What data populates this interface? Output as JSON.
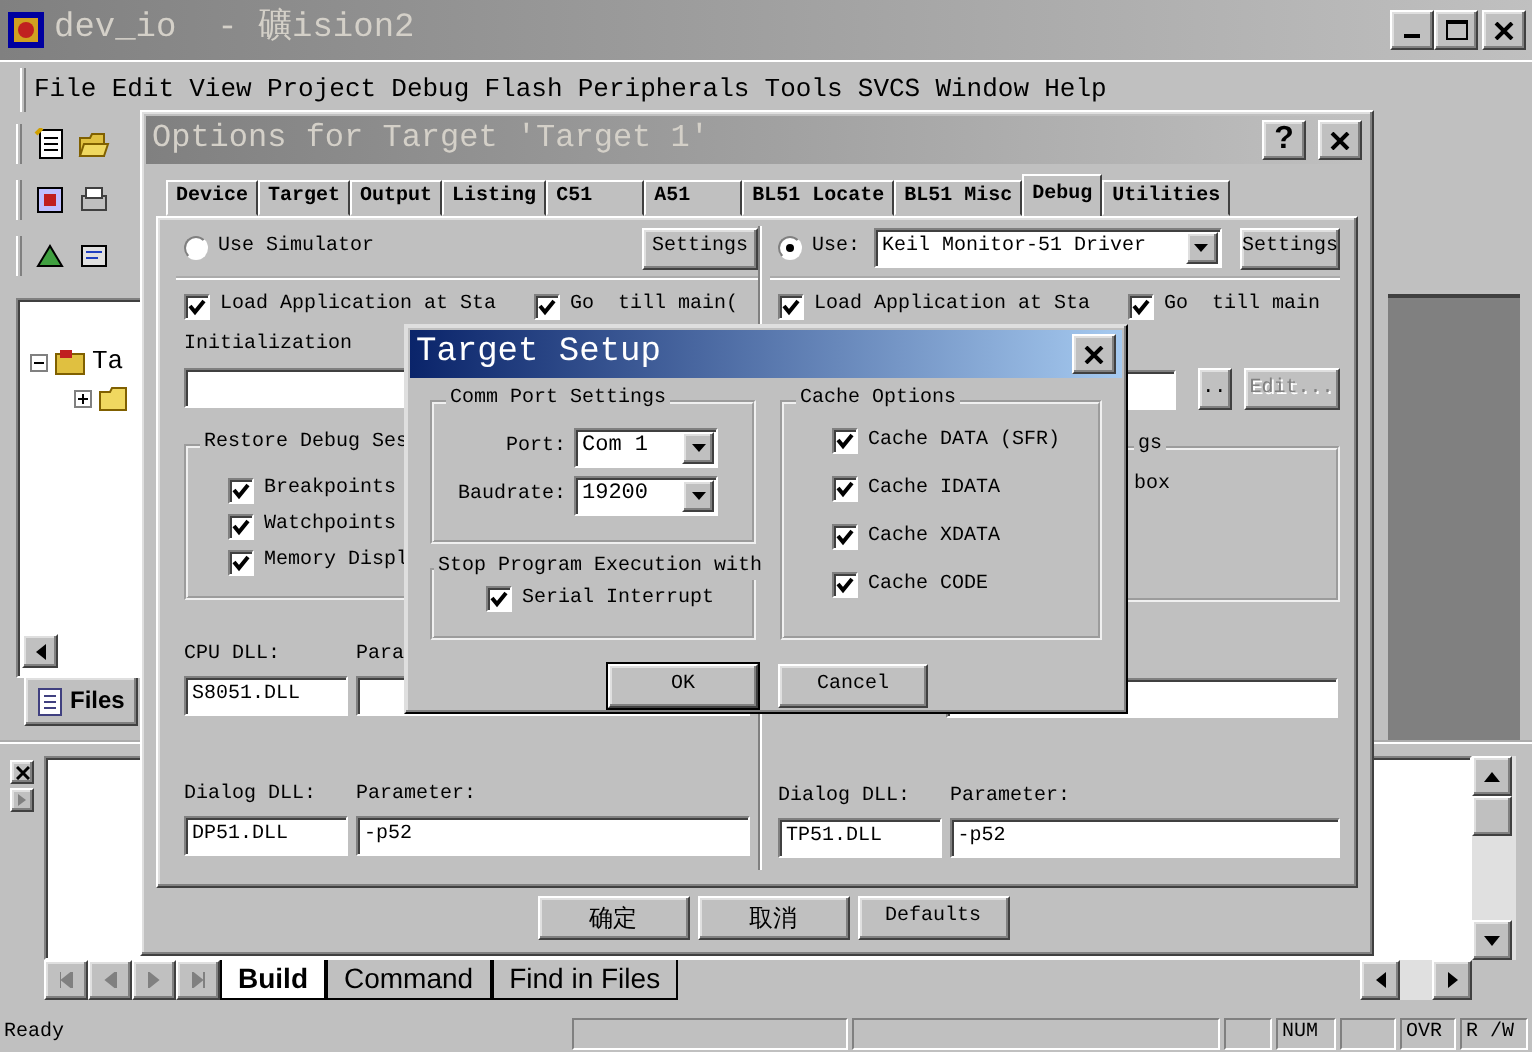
{
  "app": {
    "title": "dev_io  - 礦ision2",
    "menu": [
      "File",
      "Edit",
      "View",
      "Project",
      "Debug",
      "Flash",
      "Peripherals",
      "Tools",
      "SVCS",
      "Window",
      "Help"
    ],
    "project_tree": [
      {
        "label": "Ta",
        "expanded": true,
        "children": [
          {
            "expanded": false
          }
        ]
      }
    ],
    "project_tabs": [
      {
        "label": "Files",
        "selected": true
      }
    ],
    "output_tabs": [
      {
        "label": "Build",
        "selected": true
      },
      {
        "label": "Command",
        "selected": false
      },
      {
        "label": "Find in Files",
        "selected": false
      }
    ],
    "status_bar": {
      "text": "Ready",
      "indicators": [
        "NUM",
        "OVR",
        "R /W"
      ]
    }
  },
  "options_dialog": {
    "title": "Options for Target 'Target 1'",
    "help_button": "?",
    "tabs": [
      {
        "label": "Device",
        "selected": false
      },
      {
        "label": "Target",
        "selected": false
      },
      {
        "label": "Output",
        "selected": false
      },
      {
        "label": "Listing",
        "selected": false
      },
      {
        "label": "C51",
        "selected": false
      },
      {
        "label": "A51",
        "selected": false
      },
      {
        "label": "BL51 Locate",
        "selected": false
      },
      {
        "label": "BL51 Misc",
        "selected": false
      },
      {
        "label": "Debug",
        "selected": true
      },
      {
        "label": "Utilities",
        "selected": false
      }
    ],
    "left": {
      "mode_label": "Use Simulator",
      "selected": false,
      "settings": "Settings",
      "load_app": {
        "label": "Load Application at Sta",
        "checked": true
      },
      "go_main": {
        "label": "Go  till main(",
        "checked": true
      },
      "init_label": "Initialization",
      "restore_title": "Restore Debug Ses",
      "restore": [
        {
          "label": "Breakpoints",
          "checked": true
        },
        {
          "label": "Watchpoints",
          "checked": true
        },
        {
          "label": "Memory Displ",
          "checked": true
        }
      ],
      "cpu_dll_label": "CPU DLL:",
      "cpu_param_label": "Para",
      "cpu_dll": "S8051.DLL",
      "dialog_dll_label": "Dialog DLL:",
      "dialog_param_label": "Parameter:",
      "dialog_dll": "DP51.DLL",
      "dialog_param": "-p52"
    },
    "right": {
      "mode_label": "Use:",
      "selected": true,
      "driver": "Keil Monitor-51 Driver",
      "settings": "Settings",
      "load_app": {
        "label": "Load Application at Sta",
        "checked": true
      },
      "go_main": {
        "label": "Go  till main",
        "checked": true
      },
      "browse": "..",
      "edit": {
        "label": "Edit...",
        "disabled": true
      },
      "restore_title": "gs",
      "restore_text": "box",
      "dialog_dll_label": "Dialog DLL:",
      "dialog_param_label": "Parameter:",
      "dialog_dll": "TP51.DLL",
      "dialog_param": "-p52"
    },
    "buttons": [
      "确定",
      "取消",
      "Defaults"
    ]
  },
  "target_setup": {
    "title": "Target Setup",
    "comm_title": "Comm Port Settings",
    "port_label": "Port:",
    "port": "Com 1",
    "baud_label": "Baudrate:",
    "baud": "19200",
    "stop_title": "Stop Program Execution with",
    "serial": {
      "label": "Serial Interrupt",
      "checked": true
    },
    "cache_title": "Cache Options",
    "cache": [
      {
        "label": "Cache DATA (SFR)",
        "checked": true
      },
      {
        "label": "Cache IDATA",
        "checked": true
      },
      {
        "label": "Cache XDATA",
        "checked": true
      },
      {
        "label": "Cache CODE",
        "checked": true
      }
    ],
    "buttons": [
      "OK",
      "Cancel"
    ]
  }
}
